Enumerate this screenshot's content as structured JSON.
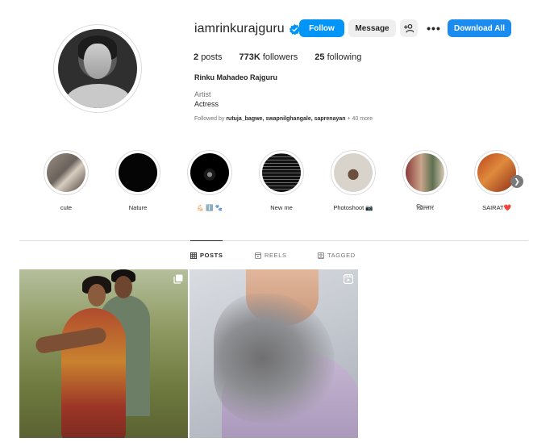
{
  "profile": {
    "username": "iamrinkurajguru",
    "full_name": "Rinku Mahadeo Rajguru",
    "category": "Artist",
    "bio": "Actress",
    "stats": {
      "posts_count": "2",
      "posts_label": "posts",
      "followers_count": "773K",
      "followers_label": "followers",
      "following_count": "25",
      "following_label": "following"
    },
    "followed_by": {
      "prefix": "Followed by",
      "names": "rutuja_bagwe, swapnilghangale, saprenayan",
      "suffix": "+ 40 more"
    }
  },
  "actions": {
    "follow": "Follow",
    "message": "Message",
    "add_user_icon": "add-user-icon",
    "more": "•••",
    "download_all": "Download All"
  },
  "highlights": [
    {
      "label": "cute"
    },
    {
      "label": "Nature"
    },
    {
      "label": "💪🏻 ℹ️ 🐾"
    },
    {
      "label": "New me"
    },
    {
      "label": "Photoshoot 📷"
    },
    {
      "label": "खिल्लार"
    },
    {
      "label": "SAIRAT❤️"
    }
  ],
  "tabs": {
    "posts": "POSTS",
    "reels": "REELS",
    "tagged": "TAGGED"
  },
  "colors": {
    "accent": "#0095f6",
    "download": "#1a8cf0",
    "secondary_button": "#efefef",
    "text": "#262626",
    "muted": "#737373",
    "border": "#dbdbdb"
  }
}
